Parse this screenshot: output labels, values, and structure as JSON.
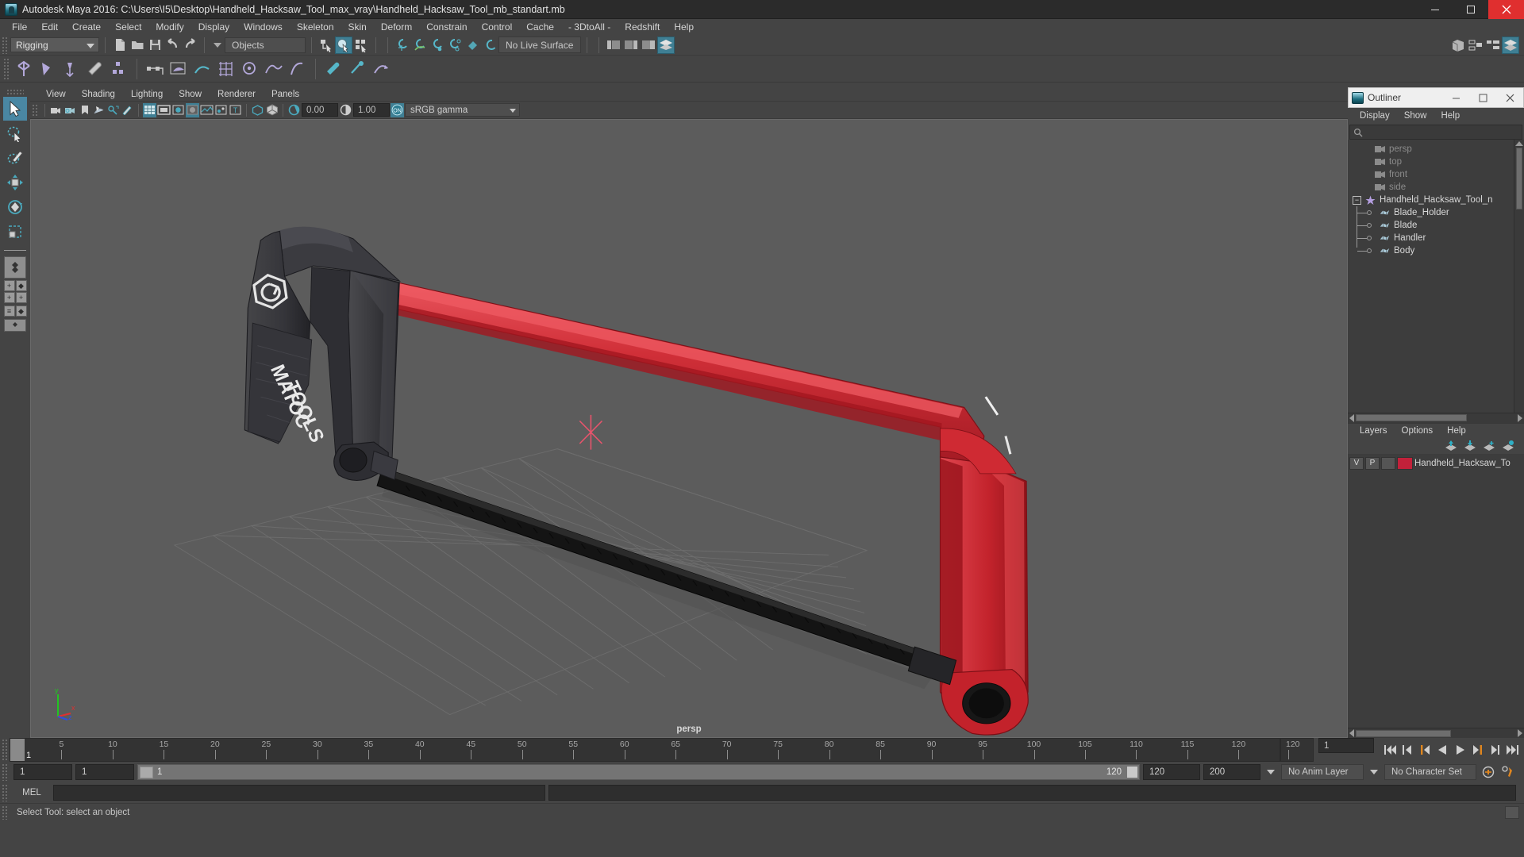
{
  "window": {
    "title": "Autodesk Maya 2016: C:\\Users\\I5\\Desktop\\Handheld_Hacksaw_Tool_max_vray\\Handheld_Hacksaw_Tool_mb_standart.mb",
    "minimize": "—",
    "maximize": "☐",
    "close": "✕"
  },
  "menubar": {
    "items": [
      {
        "label": "File"
      },
      {
        "label": "Edit"
      },
      {
        "label": "Create"
      },
      {
        "label": "Select"
      },
      {
        "label": "Modify"
      },
      {
        "label": "Display"
      },
      {
        "label": "Windows"
      },
      {
        "label": "Skeleton"
      },
      {
        "label": "Skin"
      },
      {
        "label": "Deform"
      },
      {
        "label": "Constrain"
      },
      {
        "label": "Control"
      },
      {
        "label": "Cache"
      },
      {
        "label": "- 3DtoAll -"
      },
      {
        "label": "Redshift"
      },
      {
        "label": "Help"
      }
    ]
  },
  "statusbar": {
    "menu_set": "Rigging",
    "selection_mask": "Objects",
    "live_surface": "No Live Surface"
  },
  "viewport_panel": {
    "menus": [
      {
        "label": "View"
      },
      {
        "label": "Shading"
      },
      {
        "label": "Lighting"
      },
      {
        "label": "Show"
      },
      {
        "label": "Renderer"
      },
      {
        "label": "Panels"
      }
    ],
    "exposure": "0.00",
    "gamma": "1.00",
    "color_mgmt_toggle": "ON",
    "view_transform": "sRGB gamma",
    "camera_label": "persp",
    "axis": {
      "x": "x",
      "y": "y",
      "z": "z"
    }
  },
  "outliner": {
    "title": "Outliner",
    "minimize": "—",
    "maximize": "☐",
    "close": "✕",
    "menus": [
      {
        "label": "Display"
      },
      {
        "label": "Show"
      },
      {
        "label": "Help"
      }
    ],
    "search_value": "",
    "items": [
      {
        "label": "persp",
        "type": "camera",
        "depth": 1,
        "dim": true
      },
      {
        "label": "top",
        "type": "camera",
        "depth": 1,
        "dim": true
      },
      {
        "label": "front",
        "type": "camera",
        "depth": 1,
        "dim": true
      },
      {
        "label": "side",
        "type": "camera",
        "depth": 1,
        "dim": true
      },
      {
        "label": "Handheld_Hacksaw_Tool_n",
        "type": "group",
        "depth": 0,
        "dim": false,
        "expanded": true
      },
      {
        "label": "Blade_Holder",
        "type": "mesh",
        "depth": 2,
        "dim": false
      },
      {
        "label": "Blade",
        "type": "mesh",
        "depth": 2,
        "dim": false
      },
      {
        "label": "Handler",
        "type": "mesh",
        "depth": 2,
        "dim": false
      },
      {
        "label": "Body",
        "type": "mesh",
        "depth": 2,
        "dim": false
      }
    ]
  },
  "layers": {
    "menus": [
      {
        "label": "Layers"
      },
      {
        "label": "Options"
      },
      {
        "label": "Help"
      }
    ],
    "rows": [
      {
        "visible": "V",
        "playback": "P",
        "color": "#c2213a",
        "name": "Handheld_Hacksaw_To"
      }
    ]
  },
  "timeline": {
    "current_frame": "1",
    "end_display": "120",
    "ticks": [
      {
        "value": "5",
        "pos": 5
      },
      {
        "value": "10",
        "pos": 10
      },
      {
        "value": "15",
        "pos": 15
      },
      {
        "value": "20",
        "pos": 20
      },
      {
        "value": "25",
        "pos": 25
      },
      {
        "value": "30",
        "pos": 30
      },
      {
        "value": "35",
        "pos": 35
      },
      {
        "value": "40",
        "pos": 40
      },
      {
        "value": "45",
        "pos": 45
      },
      {
        "value": "50",
        "pos": 50
      },
      {
        "value": "55",
        "pos": 55
      },
      {
        "value": "60",
        "pos": 60
      },
      {
        "value": "65",
        "pos": 65
      },
      {
        "value": "70",
        "pos": 70
      },
      {
        "value": "75",
        "pos": 75
      },
      {
        "value": "80",
        "pos": 80
      },
      {
        "value": "85",
        "pos": 85
      },
      {
        "value": "90",
        "pos": 90
      },
      {
        "value": "95",
        "pos": 95
      },
      {
        "value": "100",
        "pos": 100
      },
      {
        "value": "105",
        "pos": 105
      },
      {
        "value": "110",
        "pos": 110
      },
      {
        "value": "115",
        "pos": 115
      },
      {
        "value": "120",
        "pos": 120
      }
    ],
    "range_start": "1",
    "range_min": "1",
    "range_slider_start": "1",
    "range_slider_end": "120",
    "range_end": "120",
    "playback_end": "200",
    "anim_layer": "No Anim Layer",
    "character_set": "No Character Set",
    "playback_frame_field": "1"
  },
  "command": {
    "language": "MEL",
    "value": ""
  },
  "status": {
    "message": "Select Tool: select an object"
  },
  "model": {
    "brand_line1": "MATOC",
    "brand_line2": "TOOLS",
    "body_color": "#cf2a33",
    "handle_color": "#3b3b3f",
    "blade_color": "#171717"
  }
}
